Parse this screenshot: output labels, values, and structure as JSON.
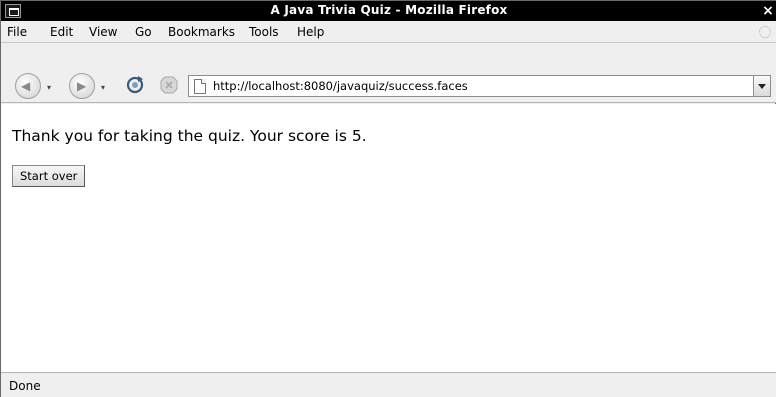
{
  "window": {
    "title": "A Java Trivia Quiz - Mozilla Firefox",
    "close_glyph": "×"
  },
  "menubar": {
    "items": [
      "File",
      "Edit",
      "View",
      "Go",
      "Bookmarks",
      "Tools",
      "Help"
    ]
  },
  "navbar": {
    "back_glyph": "◀",
    "forward_glyph": "▶",
    "dropdown_glyph": "▾",
    "url": "http://localhost:8080/javaquiz/success.faces"
  },
  "content": {
    "message": "Thank you for taking the quiz. Your score is 5.",
    "start_over_label": "Start over"
  },
  "statusbar": {
    "status": "Done"
  },
  "colors": {
    "titlebar_bg": "#000000",
    "chrome_bg": "#efefef",
    "content_bg": "#ffffff"
  }
}
